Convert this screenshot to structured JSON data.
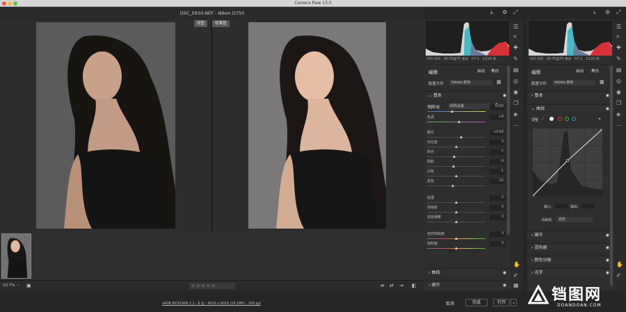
{
  "window_title": "Camera Raw 13.0",
  "file_title": "DSC_5910.NEF  -  Nikon D750",
  "view": {
    "before_label": "原图",
    "after_label": "效果图"
  },
  "status": {
    "zoom": "10.7%",
    "stars": "☆ ☆ ☆ ☆ ☆"
  },
  "footer": {
    "info": "sRGB IEC61966-2.1 - 8 位 - 4016 x 6016 (24.2MP) - 300 ppi",
    "cancel": "取消",
    "done": "完成",
    "open": "打开"
  },
  "left_panel": {
    "meta": [
      "ISO 100",
      "28-75@75 毫米",
      "f/7.1",
      "1/125 秒"
    ],
    "edit": "编辑",
    "auto": "自动",
    "bw": "黑白",
    "profile_label": "配置文件",
    "profile_value": "Adobe 颜色",
    "basic": "基本",
    "wb_label": "白平衡",
    "wb_value": "原照设置",
    "sliders": [
      {
        "name": "色温",
        "value": "5100",
        "pos": 0.44
      },
      {
        "name": "色调",
        "value": "+8",
        "pos": 0.55
      },
      {
        "name": "曝光",
        "value": "+0.60",
        "pos": 0.59
      },
      {
        "name": "对比度",
        "value": "0",
        "pos": 0.5
      },
      {
        "name": "高光",
        "value": "-7",
        "pos": 0.47
      },
      {
        "name": "阴影",
        "value": "-9",
        "pos": 0.46
      },
      {
        "name": "白色",
        "value": "-1",
        "pos": 0.5
      },
      {
        "name": "黑色",
        "value": "-10",
        "pos": 0.45
      },
      {
        "name": "纹理",
        "value": "0",
        "pos": 0.5
      },
      {
        "name": "清晰度",
        "value": "0",
        "pos": 0.5
      },
      {
        "name": "去除薄雾",
        "value": "0",
        "pos": 0.5
      },
      {
        "name": "自然饱和度",
        "value": "0",
        "pos": 0.5
      },
      {
        "name": "饱和度",
        "value": "0",
        "pos": 0.5
      }
    ],
    "curve": "曲线",
    "detail": "细节"
  },
  "right_panel": {
    "meta": [
      "ISO 100",
      "28-75@75 毫米",
      "f/7.1",
      "1/125 秒"
    ],
    "edit": "编辑",
    "auto": "自动",
    "bw": "黑白",
    "profile_label": "配置文件",
    "profile_value": "Adobe 颜色",
    "basic": "基本",
    "curve": "曲线",
    "adjust": "调整",
    "input": "输入:",
    "output": "输出:",
    "point_curve_label": "点曲线",
    "point_curve_value": "自定",
    "detail": "细节",
    "mixer": "混色器",
    "grading": "颜色分级",
    "optics": "光学"
  },
  "watermark": {
    "main": "铛图网",
    "sub": "DOANDOAN.COM"
  }
}
